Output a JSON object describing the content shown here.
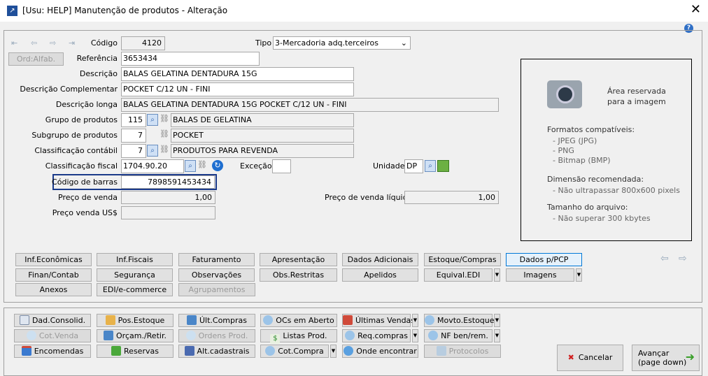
{
  "window": {
    "title": "[Usu: HELP] Manutenção de produtos - Alteração",
    "close": "✕",
    "help": "?"
  },
  "nav": {
    "ord_alfab": "Ord:Alfab."
  },
  "fields": {
    "codigo": {
      "label": "Código",
      "value": "4120"
    },
    "tipo": {
      "label": "Tipo",
      "value": "3-Mercadoria adq.terceiros"
    },
    "referencia": {
      "label": "Referência",
      "value": "3653434"
    },
    "descricao": {
      "label": "Descrição",
      "value": "BALAS GELATINA DENTADURA 15G"
    },
    "descricao_compl": {
      "label": "Descrição Complementar",
      "value": "POCKET C/12 UN - FINI"
    },
    "descricao_longa": {
      "label": "Descrição longa",
      "value": "BALAS GELATINA DENTADURA 15G POCKET C/12 UN - FINI"
    },
    "grupo": {
      "label": "Grupo de produtos",
      "code": "115",
      "name": "BALAS DE GELATINA"
    },
    "subgrupo": {
      "label": "Subgrupo de produtos",
      "code": "7",
      "name": "POCKET"
    },
    "classif_contabil": {
      "label": "Classificação contábil",
      "code": "7",
      "name": "PRODUTOS PARA REVENDA"
    },
    "classif_fiscal": {
      "label": "Classificação fiscal",
      "value": "1704.90.20"
    },
    "excecao": {
      "label": "Exceção",
      "value": ""
    },
    "unidade": {
      "label": "Unidade",
      "value": "DP"
    },
    "codigo_barras": {
      "label": "Código de barras",
      "value": "7898591453434"
    },
    "preco_venda": {
      "label": "Preço de venda",
      "value": "1,00"
    },
    "preco_liquido": {
      "label": "Preço de venda líquido",
      "value": "1,00"
    },
    "preco_usd": {
      "label": "Preço venda US$",
      "value": ""
    }
  },
  "image_panel": {
    "title1": "Área reservada",
    "title2": "para a imagem",
    "formats_title": "Formatos compatíveis:",
    "formats": [
      "- JPEG (JPG)",
      "- PNG",
      "- Bitmap (BMP)"
    ],
    "dim_title": "Dimensão recomendada:",
    "dim": "- Não ultrapassar 800x600 pixels",
    "size_title": "Tamanho do arquivo:",
    "size": "- Não superar 300 kbytes"
  },
  "tabs": [
    "Inf.Econômicas",
    "Inf.Fiscais",
    "Faturamento",
    "Apresentação",
    "Dados Adicionais",
    "Estoque/Compras",
    "Dados p/PCP",
    "Finan/Contab",
    "Segurança",
    "Observações",
    "Obs.Restritas",
    "Apelidos",
    "Equival.EDI",
    "Imagens",
    "Anexos",
    "EDI/e-commerce",
    "Agrupamentos"
  ],
  "actions": [
    "Dad.Consolid.",
    "Pos.Estoque",
    "Últ.Compras",
    "OCs em Aberto",
    "Últimas Vendas",
    "Movto.Estoque",
    "Cot.Venda",
    "Orçam./Retir.",
    "Ordens Prod.",
    "Listas Prod.",
    "Req.compras",
    "NF ben/rem.",
    "Encomendas",
    "Reservas",
    "Alt.cadastrais",
    "Cot.Compra",
    "Onde encontrar",
    "Protocolos"
  ],
  "footer": {
    "cancel": "Cancelar",
    "next1": "Avançar",
    "next2": "(page down)"
  }
}
